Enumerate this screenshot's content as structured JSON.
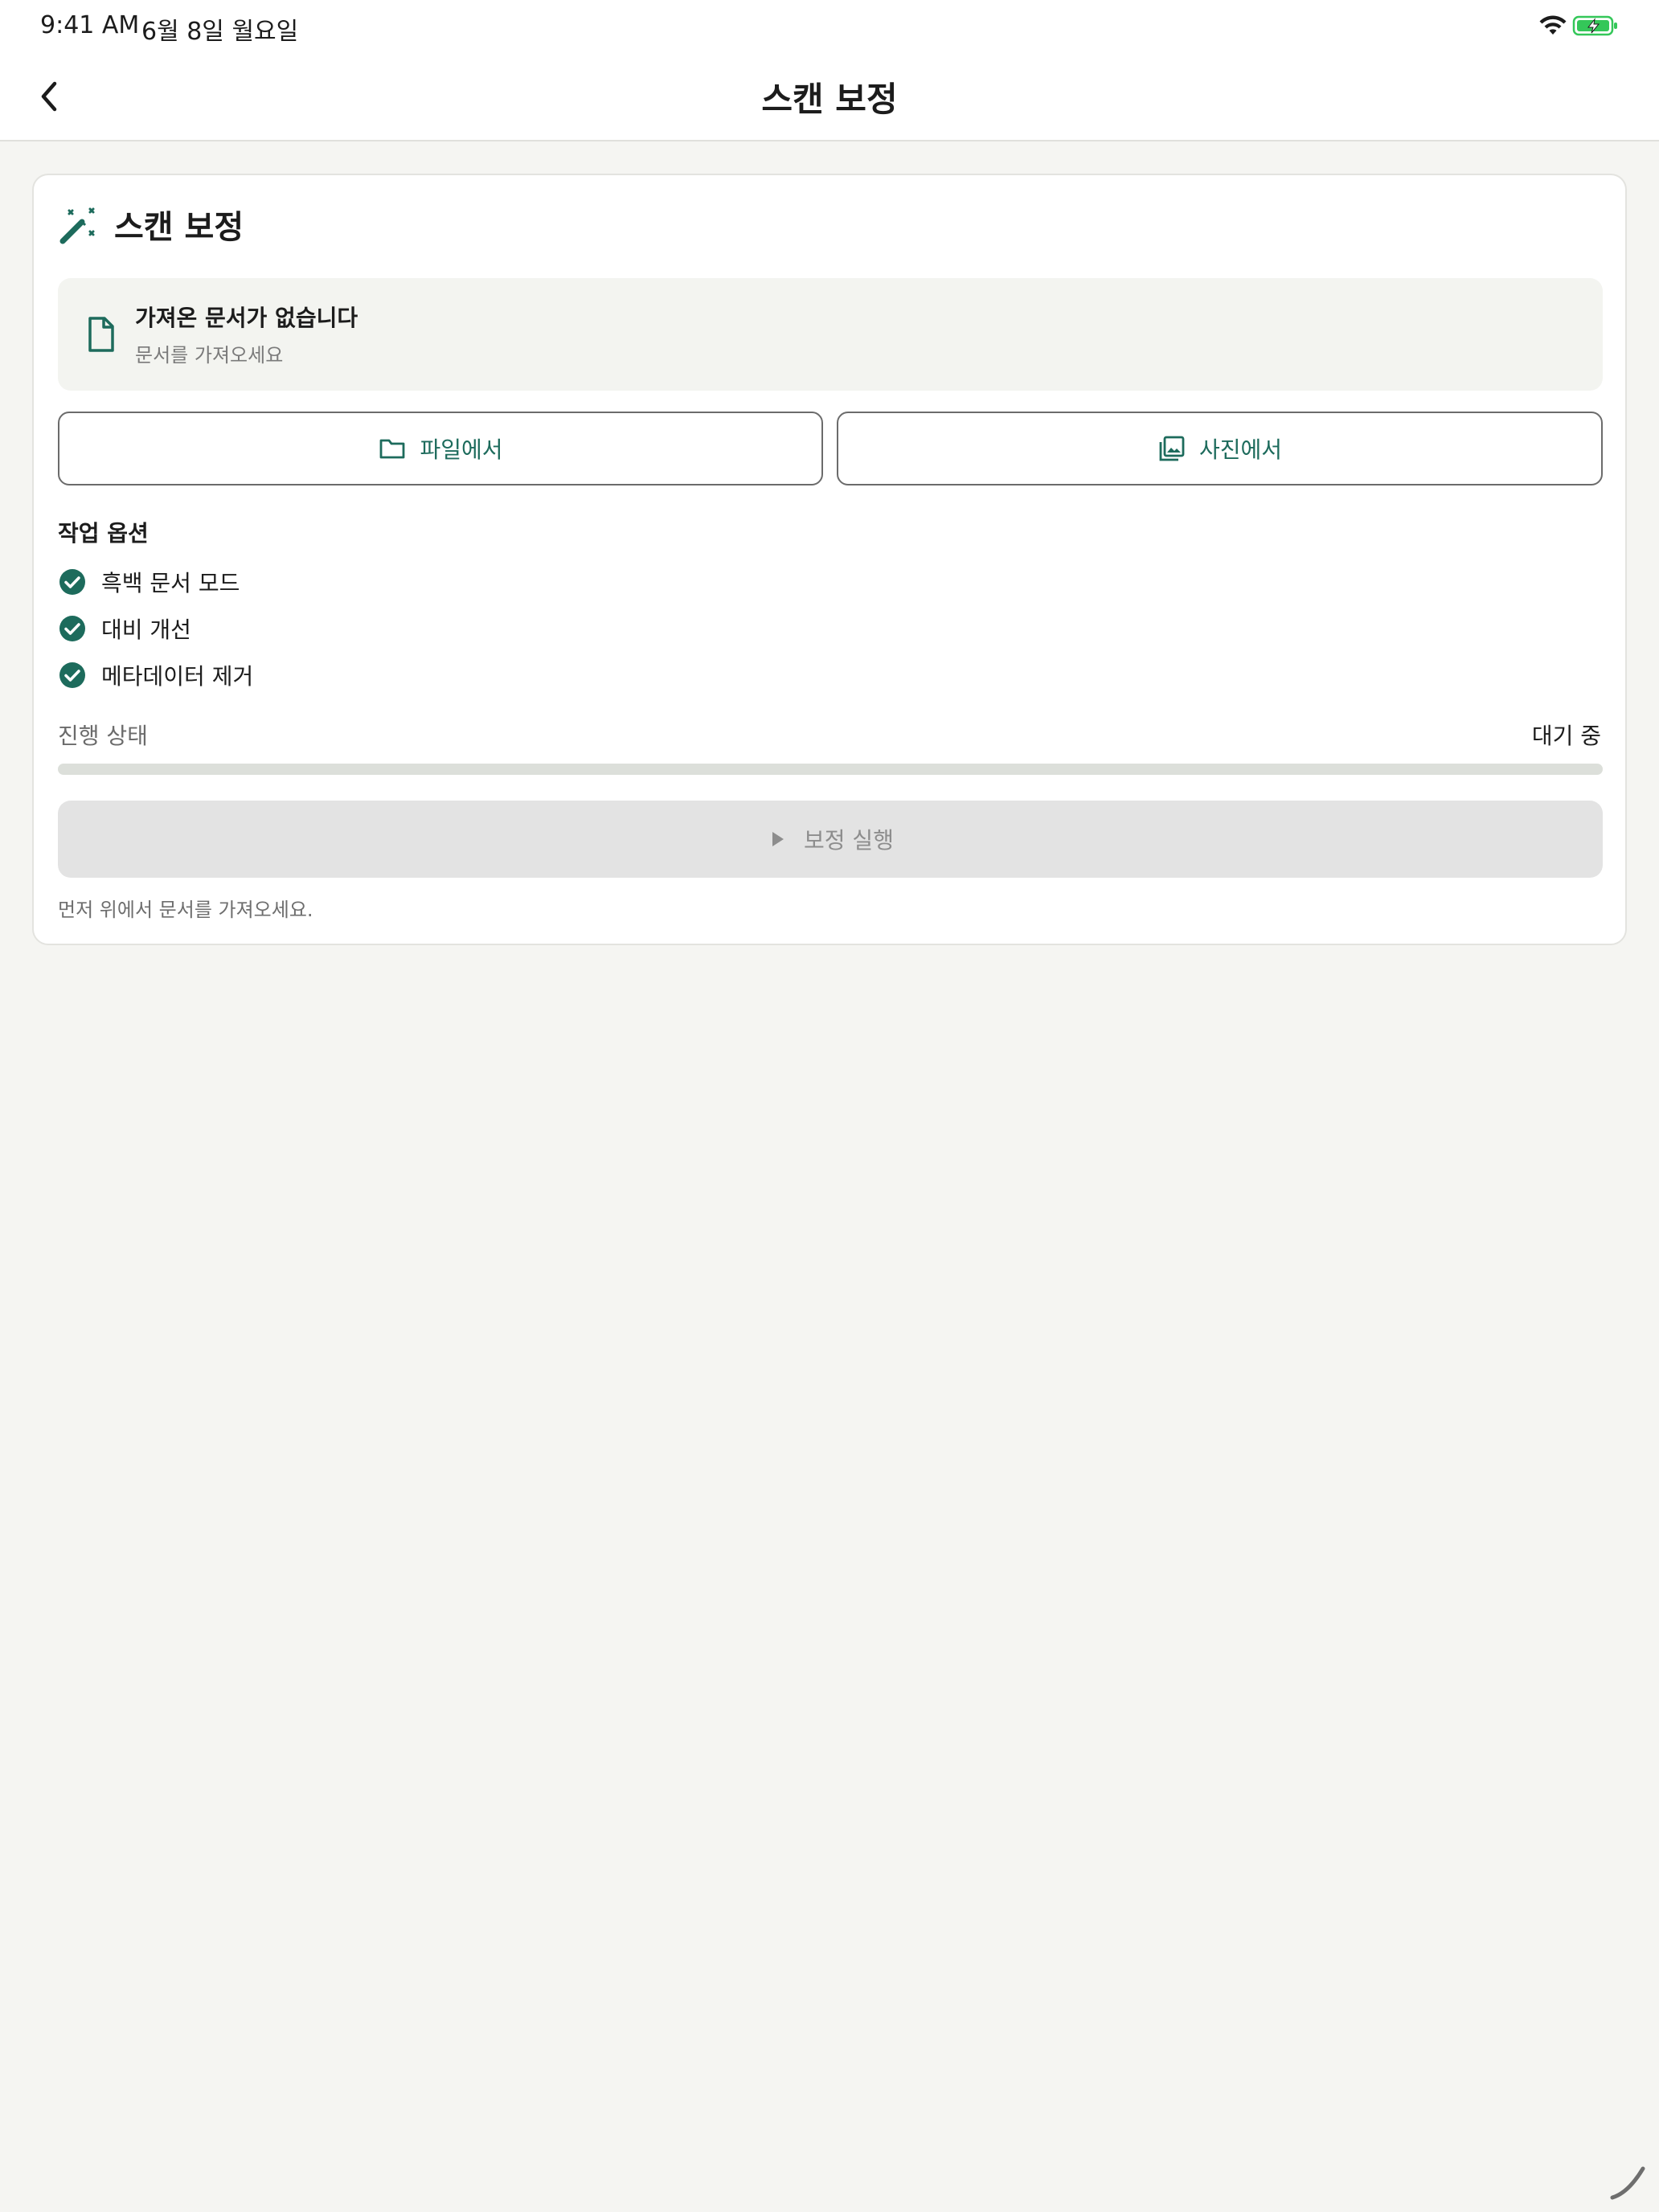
{
  "status_bar": {
    "time": "9:41 AM",
    "date": "6월 8일 월요일",
    "icons": [
      "wifi-icon",
      "battery-charging-icon"
    ]
  },
  "nav": {
    "title": "스캔 보정",
    "back_icon": "chevron-left-icon"
  },
  "card": {
    "title": "스캔 보정",
    "icon": "magic-wand-icon",
    "document": {
      "icon": "document-icon",
      "title": "가져온 문서가 없습니다",
      "subtitle": "문서를 가져오세요"
    },
    "import_buttons": {
      "files_label": "파일에서",
      "files_icon": "folder-icon",
      "photos_label": "사진에서",
      "photos_icon": "photo-library-icon"
    },
    "options": {
      "label": "작업 옵션",
      "items": [
        {
          "label": "흑백 문서 모드",
          "checked": true
        },
        {
          "label": "대비 개선",
          "checked": true
        },
        {
          "label": "메타데이터 제거",
          "checked": true
        }
      ]
    },
    "progress": {
      "label": "진행 상태",
      "status": "대기 중",
      "value": 0
    },
    "run_button": {
      "label": "보정 실행",
      "icon": "play-icon",
      "enabled": false
    },
    "hint": "먼저 위에서 문서를 가져오세요."
  },
  "colors": {
    "accent": "#1d6b5c",
    "background": "#f5f5f2",
    "card": "#ffffff",
    "disabled_button": "#e3e3e3"
  }
}
